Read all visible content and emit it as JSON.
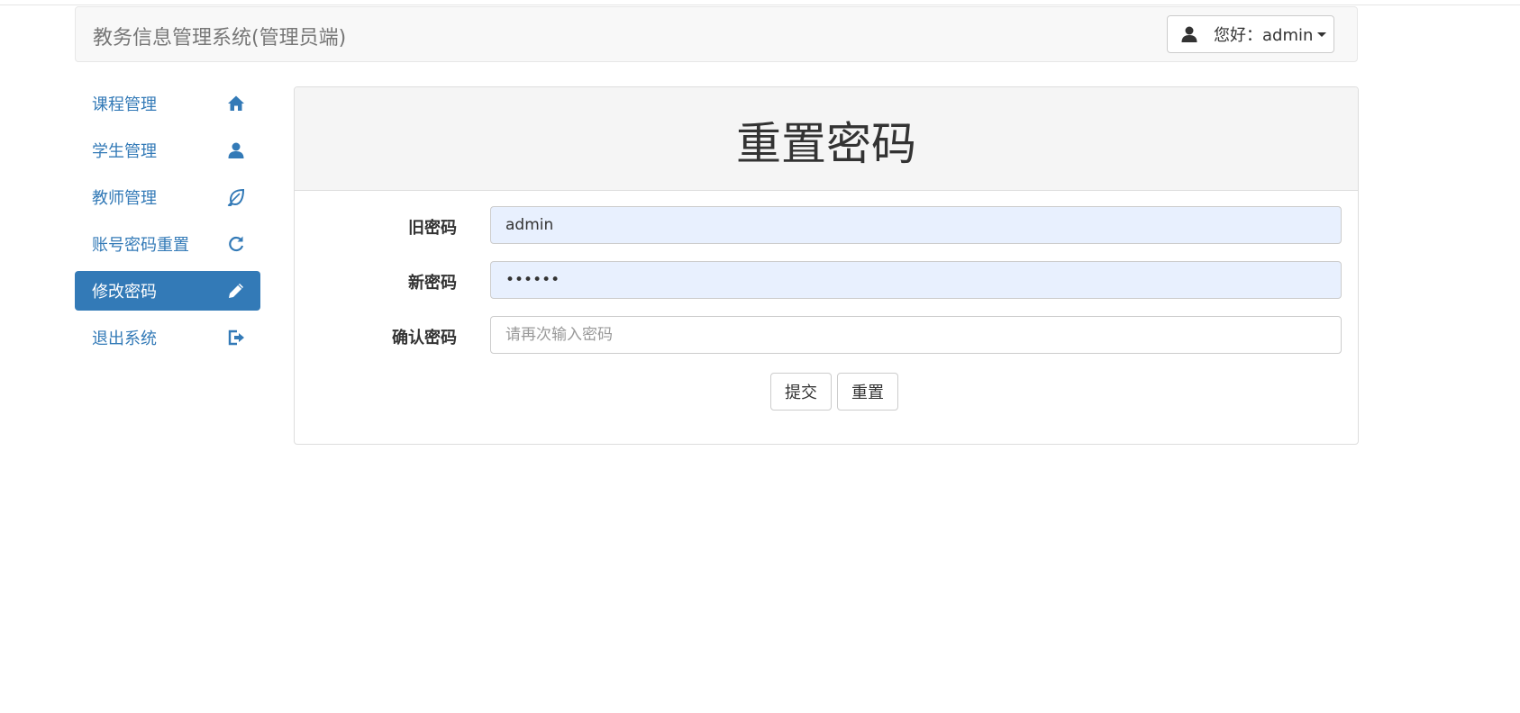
{
  "header": {
    "brand": "教务信息管理系统(管理员端)",
    "user_greeting": "您好：admin"
  },
  "sidebar": {
    "items": [
      {
        "label": "课程管理",
        "icon": "home-icon",
        "active": false
      },
      {
        "label": "学生管理",
        "icon": "user-icon",
        "active": false
      },
      {
        "label": "教师管理",
        "icon": "leaf-icon",
        "active": false
      },
      {
        "label": "账号密码重置",
        "icon": "refresh-icon",
        "active": false
      },
      {
        "label": "修改密码",
        "icon": "pencil-icon",
        "active": true
      },
      {
        "label": "退出系统",
        "icon": "logout-icon",
        "active": false
      }
    ]
  },
  "panel": {
    "title": "重置密码"
  },
  "form": {
    "old_password": {
      "label": "旧密码",
      "value": "admin"
    },
    "new_password": {
      "label": "新密码",
      "value": "••••••"
    },
    "confirm_password": {
      "label": "确认密码",
      "value": "",
      "placeholder": "请再次输入密码"
    },
    "submit_label": "提交",
    "reset_label": "重置"
  },
  "colors": {
    "accent": "#337ab7",
    "autofill": "#e8f0fe"
  }
}
